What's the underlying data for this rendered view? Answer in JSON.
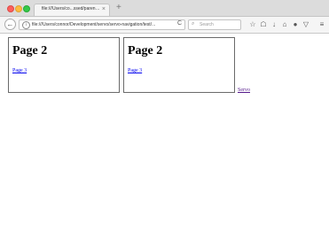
{
  "tab": {
    "title": "file:///Users/co...ssed/parent.html",
    "close": "×",
    "new_tab": "+"
  },
  "nav": {
    "back": "←",
    "info": "i",
    "url": "file:///Users/connor/Development/servo/servo-navigation/test/...",
    "reload": "C",
    "search_placeholder": "Search",
    "search_glyph": "⌕",
    "toolbar_icons": [
      "star-icon",
      "library-icon",
      "download-icon",
      "home-icon",
      "pocket-icon",
      "shield-icon",
      "menu-icon"
    ],
    "toolbar_glyphs": [
      "☆",
      "☖",
      "↓",
      "⌂",
      "●",
      "▽",
      "≡"
    ]
  },
  "content": {
    "frames": [
      {
        "heading": "Page 2",
        "link": "Page 3"
      },
      {
        "heading": "Page 2",
        "link": "Page 3"
      }
    ],
    "servo_link": "Servo"
  }
}
